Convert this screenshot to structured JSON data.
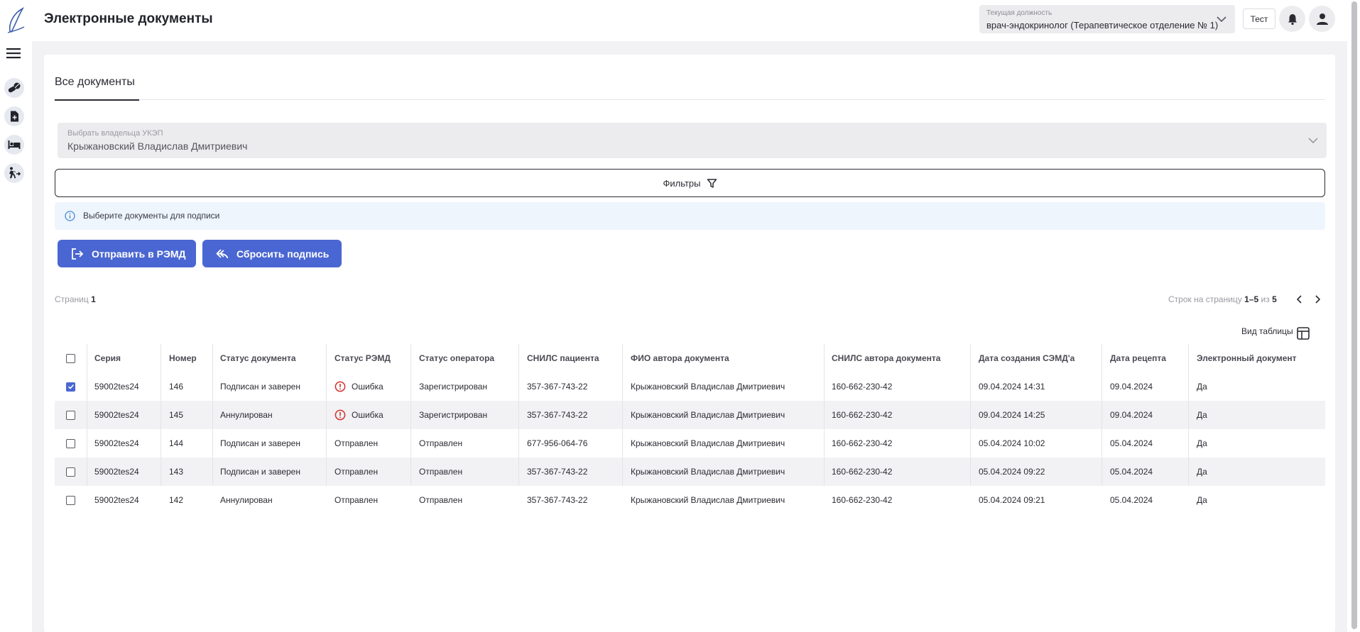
{
  "header": {
    "title": "Электронные документы",
    "position_label": "Текущая должность",
    "position_value": "врач-эндокринолог (Терапевтическое отделение № 1)",
    "test_label": "Тест"
  },
  "tabs": [
    {
      "label": "Все документы"
    }
  ],
  "owner": {
    "label": "Выбрать владельца УКЭП",
    "value": "Крыжановский Владислав Дмитриевич"
  },
  "filters_label": "Фильтры",
  "info_text": "Выберите документы для подписи",
  "actions": {
    "send_label": "Отправить в РЭМД",
    "reset_label": "Сбросить подпись"
  },
  "pagination": {
    "pages_label": "Страниц",
    "pages_value": "1",
    "rows_label": "Строк на страницу",
    "rows_range": "1–5",
    "of_label": "из",
    "total": "5"
  },
  "view_label": "Вид таблицы",
  "columns": [
    "Серия",
    "Номер",
    "Статус документа",
    "Статус РЭМД",
    "Статус оператора",
    "СНИЛС пациента",
    "ФИО автора документа",
    "СНИЛС автора документа",
    "Дата создания СЭМД'а",
    "Дата рецепта",
    "Электронный документ"
  ],
  "rows": [
    {
      "checked": true,
      "series": "59002tes24",
      "number": "146",
      "doc_status": "Подписан и заверен",
      "remd_status": "Ошибка",
      "remd_error": true,
      "operator_status": "Зарегистрирован",
      "patient_snils": "357-367-743-22",
      "author": "Крыжановский Владислав Дмитриевич",
      "author_snils": "160-662-230-42",
      "created": "09.04.2024 14:31",
      "recipe_date": "09.04.2024",
      "electronic": "Да"
    },
    {
      "checked": false,
      "series": "59002tes24",
      "number": "145",
      "doc_status": "Аннулирован",
      "remd_status": "Ошибка",
      "remd_error": true,
      "operator_status": "Зарегистрирован",
      "patient_snils": "357-367-743-22",
      "author": "Крыжановский Владислав Дмитриевич",
      "author_snils": "160-662-230-42",
      "created": "09.04.2024 14:25",
      "recipe_date": "09.04.2024",
      "electronic": "Да"
    },
    {
      "checked": false,
      "series": "59002tes24",
      "number": "144",
      "doc_status": "Подписан и заверен",
      "remd_status": "Отправлен",
      "remd_error": false,
      "operator_status": "Отправлен",
      "patient_snils": "677-956-064-76",
      "author": "Крыжановский Владислав Дмитриевич",
      "author_snils": "160-662-230-42",
      "created": "05.04.2024 10:02",
      "recipe_date": "05.04.2024",
      "electronic": "Да"
    },
    {
      "checked": false,
      "series": "59002tes24",
      "number": "143",
      "doc_status": "Подписан и заверен",
      "remd_status": "Отправлен",
      "remd_error": false,
      "operator_status": "Отправлен",
      "patient_snils": "357-367-743-22",
      "author": "Крыжановский Владислав Дмитриевич",
      "author_snils": "160-662-230-42",
      "created": "05.04.2024 09:22",
      "recipe_date": "05.04.2024",
      "electronic": "Да"
    },
    {
      "checked": false,
      "series": "59002tes24",
      "number": "142",
      "doc_status": "Аннулирован",
      "remd_status": "Отправлен",
      "remd_error": false,
      "operator_status": "Отправлен",
      "patient_snils": "357-367-743-22",
      "author": "Крыжановский Владислав Дмитриевич",
      "author_snils": "160-662-230-42",
      "created": "05.04.2024 09:21",
      "recipe_date": "05.04.2024",
      "electronic": "Да"
    }
  ],
  "colors": {
    "accent": "#4a66d2",
    "error": "#d0312d",
    "info_bg": "#eef5fc"
  },
  "icons": {
    "sidebar": [
      "pills-icon",
      "document-plus-icon",
      "bed-icon",
      "discharge-icon"
    ]
  }
}
